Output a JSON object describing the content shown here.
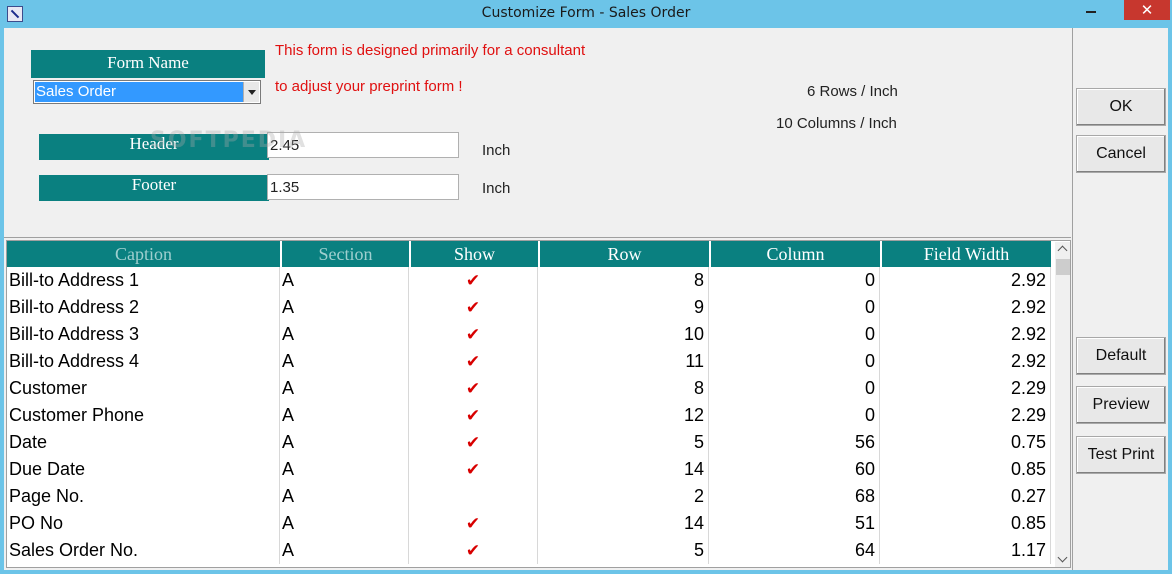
{
  "window": {
    "title": "Customize Form - Sales Order",
    "close_glyph": "✕"
  },
  "form": {
    "form_name_label": "Form Name",
    "form_name_value": "Sales Order",
    "note_line1": "This form is designed primarily for a consultant",
    "note_line2": "to adjust your preprint form !",
    "rows_per_inch": "6 Rows / Inch",
    "columns_per_inch": "10 Columns / Inch",
    "header_label": "Header",
    "header_value": "2.45",
    "footer_label": "Footer",
    "footer_value": "1.35",
    "unit": "Inch",
    "watermark": "SOFTPEDIA"
  },
  "grid": {
    "columns": [
      "Caption",
      "Section",
      "Show",
      "Row",
      "Column",
      "Field Width"
    ],
    "rows": [
      {
        "caption": "Bill-to Address 1",
        "section": "A",
        "show": "✔",
        "row": "8",
        "column": "0",
        "width": "2.92"
      },
      {
        "caption": "Bill-to Address 2",
        "section": "A",
        "show": "✔",
        "row": "9",
        "column": "0",
        "width": "2.92"
      },
      {
        "caption": "Bill-to Address 3",
        "section": "A",
        "show": "✔",
        "row": "10",
        "column": "0",
        "width": "2.92"
      },
      {
        "caption": "Bill-to Address 4",
        "section": "A",
        "show": "✔",
        "row": "11",
        "column": "0",
        "width": "2.92"
      },
      {
        "caption": "Customer",
        "section": "A",
        "show": "✔",
        "row": "8",
        "column": "0",
        "width": "2.29"
      },
      {
        "caption": "Customer Phone",
        "section": "A",
        "show": "✔",
        "row": "12",
        "column": "0",
        "width": "2.29"
      },
      {
        "caption": "Date",
        "section": "A",
        "show": "✔",
        "row": "5",
        "column": "56",
        "width": "0.75"
      },
      {
        "caption": "Due Date",
        "section": "A",
        "show": "✔",
        "row": "14",
        "column": "60",
        "width": "0.85"
      },
      {
        "caption": "Page No.",
        "section": "A",
        "show": "",
        "row": "2",
        "column": "68",
        "width": "0.27"
      },
      {
        "caption": "PO No",
        "section": "A",
        "show": "✔",
        "row": "14",
        "column": "51",
        "width": "0.85"
      },
      {
        "caption": "Sales Order No.",
        "section": "A",
        "show": "✔",
        "row": "5",
        "column": "64",
        "width": "1.17"
      }
    ]
  },
  "buttons": {
    "ok": "OK",
    "cancel": "Cancel",
    "default": "Default",
    "preview": "Preview",
    "test_print": "Test Print"
  }
}
